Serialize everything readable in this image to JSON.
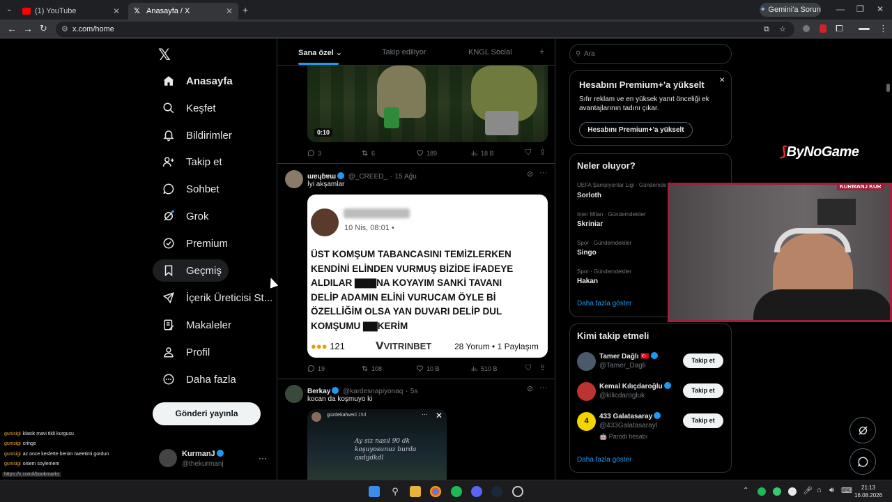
{
  "browser": {
    "tabs": [
      {
        "label": "(1) YouTube",
        "color": "#ff0000"
      },
      {
        "label": "Anasayfa / X",
        "color": "#ffffff"
      }
    ],
    "url": "x.com/home",
    "gemini_label": "Gemini'a Sorun"
  },
  "nav": {
    "items": [
      {
        "label": "Anasayfa",
        "icon": "home-icon"
      },
      {
        "label": "Keşfet",
        "icon": "search-icon"
      },
      {
        "label": "Bildirimler",
        "icon": "bell-icon"
      },
      {
        "label": "Takip et",
        "icon": "follow-icon"
      },
      {
        "label": "Sohbet",
        "icon": "chat-icon"
      },
      {
        "label": "Grok",
        "icon": "grok-icon"
      },
      {
        "label": "Premium",
        "icon": "premium-icon"
      },
      {
        "label": "Geçmiş",
        "icon": "bookmark-icon"
      },
      {
        "label": "İçerik Üreticisi St...",
        "icon": "rocket-icon"
      },
      {
        "label": "Makaleler",
        "icon": "article-icon"
      },
      {
        "label": "Profil",
        "icon": "profile-icon"
      },
      {
        "label": "Daha fazla",
        "icon": "more-icon"
      }
    ],
    "post_label": "Gönderi yayınla",
    "user": {
      "name": "KurmanJ",
      "handle": "@thekurmanj"
    }
  },
  "feed": {
    "tabs": [
      "Sana özel",
      "Takip ediliyor",
      "KNGL Social"
    ],
    "tweet0": {
      "video_time": "0:10",
      "replies": "3",
      "retweets": "6",
      "likes": "189",
      "views": "18 B"
    },
    "tweet1": {
      "name": "ɯɐɥɓɐɯ",
      "handle": "@_CREED_",
      "time": "15 Ağu",
      "text": "İyi akşamlar",
      "image": {
        "time": "10 Nis, 08:01 •",
        "lines": [
          "ÜST KOMŞUM TABANCASINI TEMİZLERKEN",
          "KENDİNİ ELİNDEN VURMUŞ BİZİDE İFADEYE",
          "ALDILAR ▇▇▇NA KOYAYIM SANKİ TAVANI",
          "DELİP ADAMIN ELİNİ VURUCAM ÖYLE Bİ",
          "ÖZELLİĞİM OLSA YAN DUVARI DELİP DUL",
          "KOMŞUMU ▇▇KERİM"
        ],
        "reactions": "121",
        "brand": "VITRINBET",
        "stats": "28 Yorum • 1 Paylaşım"
      },
      "replies": "19",
      "retweets": "108",
      "likes": "10 B",
      "views": "510 B"
    },
    "tweet2": {
      "name": "Berkay",
      "handle": "@kardesnapiyonaq",
      "time": "5s",
      "text": "kocan da koşmuyo ki",
      "embed_user": "gozdekahveci",
      "embed_time": "15d",
      "embed_text": "Ay siz nasıl 90 dk koşuyosunuz burda asdıjdkdl"
    }
  },
  "right": {
    "search_placeholder": "Ara",
    "premium": {
      "title": "Hesabını Premium+'a yükselt",
      "desc": "Sıfır reklam ve en yüksek yanıt önceliği ek avantajlarının tadını çıkar.",
      "button": "Hesabını Premium+'a yükselt"
    },
    "trends": {
      "title": "Neler oluyor?",
      "items": [
        {
          "cat": "UEFA Şampiyonlar Ligi · Gündemde",
          "name": "Sorloth"
        },
        {
          "cat": "Inter Milan · Gündemdekiler",
          "name": "Skriniar"
        },
        {
          "cat": "Spor · Gündemdekiler",
          "name": "Singo"
        },
        {
          "cat": "Spor · Gündemdekiler",
          "name": "Hakan"
        }
      ],
      "more": "Daha fazla göster"
    },
    "who": {
      "title": "Kimi takip etmeli",
      "items": [
        {
          "name": "Tamer Dağlı 🇹🇷",
          "handle": "@Tamer_Dagli",
          "extra": "",
          "button": "Takip et"
        },
        {
          "name": "Kemal Kılıçdaroğlu",
          "handle": "@kilicdarogluk",
          "extra": "",
          "button": "Takip et"
        },
        {
          "name": "433 Galatasaray",
          "handle": "@433Galatasarayl",
          "extra": "🤖 Parodi hesabı",
          "button": "Takip et"
        }
      ],
      "more": "Daha fazla göster"
    }
  },
  "overlay": {
    "logo": "ByNoGame",
    "cam_label": "KURMANJ  KUR",
    "chat": [
      {
        "user": "gunisigi",
        "msg": "klasik mavi tikli kurgusu"
      },
      {
        "user": "gunisigi",
        "msg": "cringe"
      },
      {
        "user": "gunisigi",
        "msg": "az once kesfette benim tweetimi gordun"
      },
      {
        "user": "gunisigi",
        "msg": "oisem soylemem"
      }
    ],
    "status_url": "https://x.com/i/bookmarks"
  },
  "taskbar": {
    "time": "21:13",
    "date": "16.08.2026"
  }
}
